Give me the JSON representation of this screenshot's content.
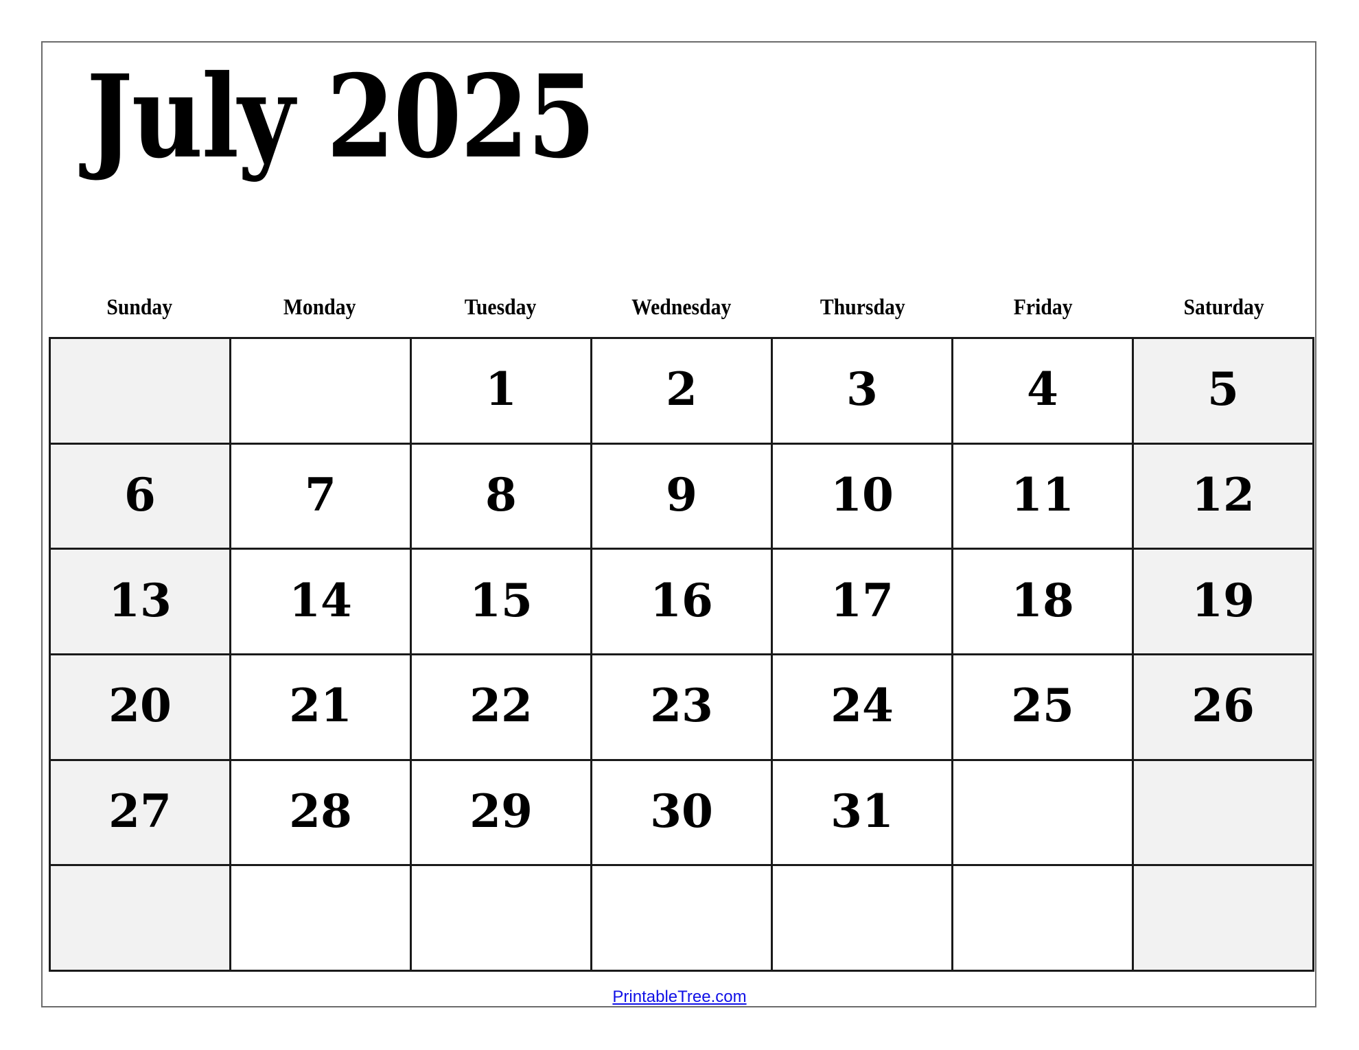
{
  "title": "July 2025",
  "weekdays": [
    "Sunday",
    "Monday",
    "Tuesday",
    "Wednesday",
    "Thursday",
    "Friday",
    "Saturday"
  ],
  "weeks": [
    [
      "",
      "",
      "1",
      "2",
      "3",
      "4",
      "5"
    ],
    [
      "6",
      "7",
      "8",
      "9",
      "10",
      "11",
      "12"
    ],
    [
      "13",
      "14",
      "15",
      "16",
      "17",
      "18",
      "19"
    ],
    [
      "20",
      "21",
      "22",
      "23",
      "24",
      "25",
      "26"
    ],
    [
      "27",
      "28",
      "29",
      "30",
      "31",
      "",
      ""
    ],
    [
      "",
      "",
      "",
      "",
      "",
      "",
      ""
    ]
  ],
  "colors": {
    "weekend_fill": "#f2f2f2",
    "weekday_fill": "#ffffff",
    "grid_line": "#1a1a1a",
    "link": "#1010e6"
  },
  "footer": {
    "link_text": "PrintableTree.com"
  }
}
